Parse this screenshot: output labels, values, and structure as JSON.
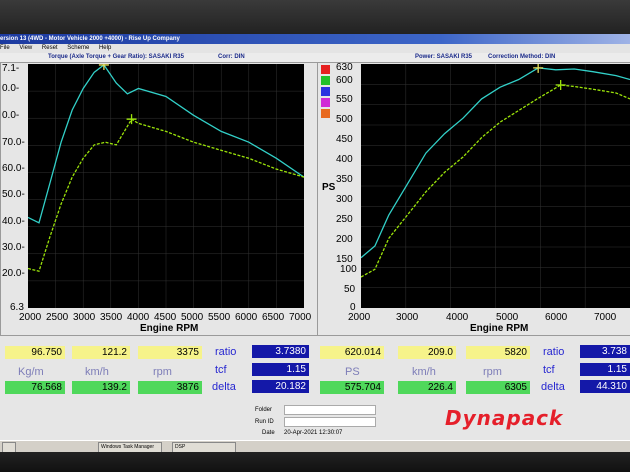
{
  "window": {
    "title": "ersion 13 (4WD - Motor Vehicle 2000 +4000) - Rise Up Company",
    "menu": [
      "File",
      "View",
      "Reset",
      "Scheme",
      "Help"
    ]
  },
  "header": {
    "torque": "Torque (Axle Torque + Gear Ratio): SASAKI R35",
    "torque_corr": "Corr: DIN",
    "power": "Power: SASAKI R35",
    "power_corr": "Correction Method: DIN"
  },
  "left_chart": {
    "yticks": [
      "7.1",
      "0.0",
      "0.0",
      "0.0",
      "0.0",
      "0.0",
      "0.0",
      "0.0",
      "6.3"
    ],
    "yticks_shown": [
      "7.1-",
      "0.0-",
      "0.0-",
      "70.0-",
      "60.0-",
      "50.0-",
      "40.0-",
      "30.0-",
      "20.0-",
      "6.3"
    ],
    "xticks": [
      "2000",
      "2500",
      "3000",
      "3500",
      "4000",
      "4500",
      "5000",
      "5500",
      "6000",
      "6500",
      "7000"
    ],
    "xlabel": "Engine RPM"
  },
  "right_chart": {
    "yticks": [
      "630",
      "600",
      "550",
      "500",
      "450",
      "400",
      "350",
      "300",
      "250",
      "200",
      "150",
      "100",
      "50",
      "0"
    ],
    "xticks": [
      "2000",
      "3000",
      "4000",
      "5000",
      "6000",
      "7000"
    ],
    "xlabel": "Engine RPM",
    "ylabel": "PS"
  },
  "chart_data": [
    {
      "type": "line",
      "xlabel": "Engine RPM",
      "xlim": [
        2000,
        7000
      ],
      "ylim": [
        6.3,
        97.1
      ],
      "series": [
        {
          "x": [
            2000,
            2200,
            2400,
            2600,
            2800,
            3000,
            3200,
            3375,
            3600,
            3800,
            4000,
            4500,
            5000,
            5500,
            6000,
            6500,
            7000
          ],
          "values": [
            40,
            38,
            53,
            68,
            80,
            88,
            94,
            96.75,
            90,
            86,
            88,
            85,
            78,
            72,
            68,
            62,
            55
          ],
          "color": "#32d0c8"
        },
        {
          "x": [
            2000,
            2200,
            2400,
            2600,
            2800,
            3000,
            3200,
            3400,
            3600,
            3876,
            4000,
            4500,
            5000,
            5500,
            6000,
            6500,
            7000
          ],
          "values": [
            21,
            20,
            33,
            45,
            55,
            62,
            67,
            68,
            67,
            76.57,
            75,
            72,
            68,
            65,
            62,
            58,
            55
          ],
          "color": "#9be30a"
        }
      ]
    },
    {
      "type": "line",
      "xlabel": "Engine RPM",
      "ylabel": "PS",
      "xlim": [
        2000,
        7800
      ],
      "ylim": [
        0,
        630
      ],
      "series": [
        {
          "x": [
            2000,
            2300,
            2600,
            3000,
            3400,
            3800,
            4200,
            4600,
            5000,
            5400,
            5820,
            6200,
            6600,
            7000,
            7500,
            7800
          ],
          "values": [
            130,
            160,
            240,
            320,
            400,
            450,
            490,
            540,
            570,
            590,
            620,
            615,
            617,
            610,
            600,
            590
          ],
          "color": "#32d0c8"
        },
        {
          "x": [
            2000,
            2300,
            2600,
            3000,
            3400,
            3800,
            4200,
            4600,
            5000,
            5400,
            5800,
            6305,
            6600,
            7000,
            7500,
            7800
          ],
          "values": [
            80,
            100,
            180,
            240,
            300,
            350,
            390,
            440,
            480,
            510,
            540,
            575.7,
            572,
            565,
            555,
            540
          ],
          "color": "#9be30a"
        }
      ]
    }
  ],
  "readouts": {
    "row1_left": {
      "torque": "96.750",
      "speed": "121.2",
      "rpm": "3375"
    },
    "row2_left": {
      "torque": "76.568",
      "speed": "139.2",
      "rpm": "3876"
    },
    "units_left": {
      "torque": "Kg/m",
      "speed": "km/h",
      "rpm": "rpm"
    },
    "ratio_label": "ratio",
    "ratio_left": "3.7380",
    "tcf_label": "tcf",
    "tcf_left": "1.15",
    "delta_label": "delta",
    "delta_left": "20.182",
    "row1_right": {
      "power": "620.014",
      "speed": "209.0",
      "rpm": "5820"
    },
    "row2_right": {
      "power": "575.704",
      "speed": "226.4",
      "rpm": "6305"
    },
    "units_right": {
      "power": "PS",
      "speed": "km/h",
      "rpm": "rpm"
    },
    "ratio_right": "3.738",
    "tcf_right": "1.15",
    "delta_right": "44.310"
  },
  "info": {
    "folder_label": "Folder",
    "runid_label": "Run ID",
    "date_label": "Date",
    "date_value": "20-Apr-2021 12:30:07"
  },
  "logo": "Dynapack",
  "taskbar": {
    "items": [
      "Windows Task Manager",
      "DSP"
    ]
  },
  "colors": {
    "torque_power": "#32d0c8",
    "secondary": "#9be30a",
    "logo": "#e51f2a"
  }
}
